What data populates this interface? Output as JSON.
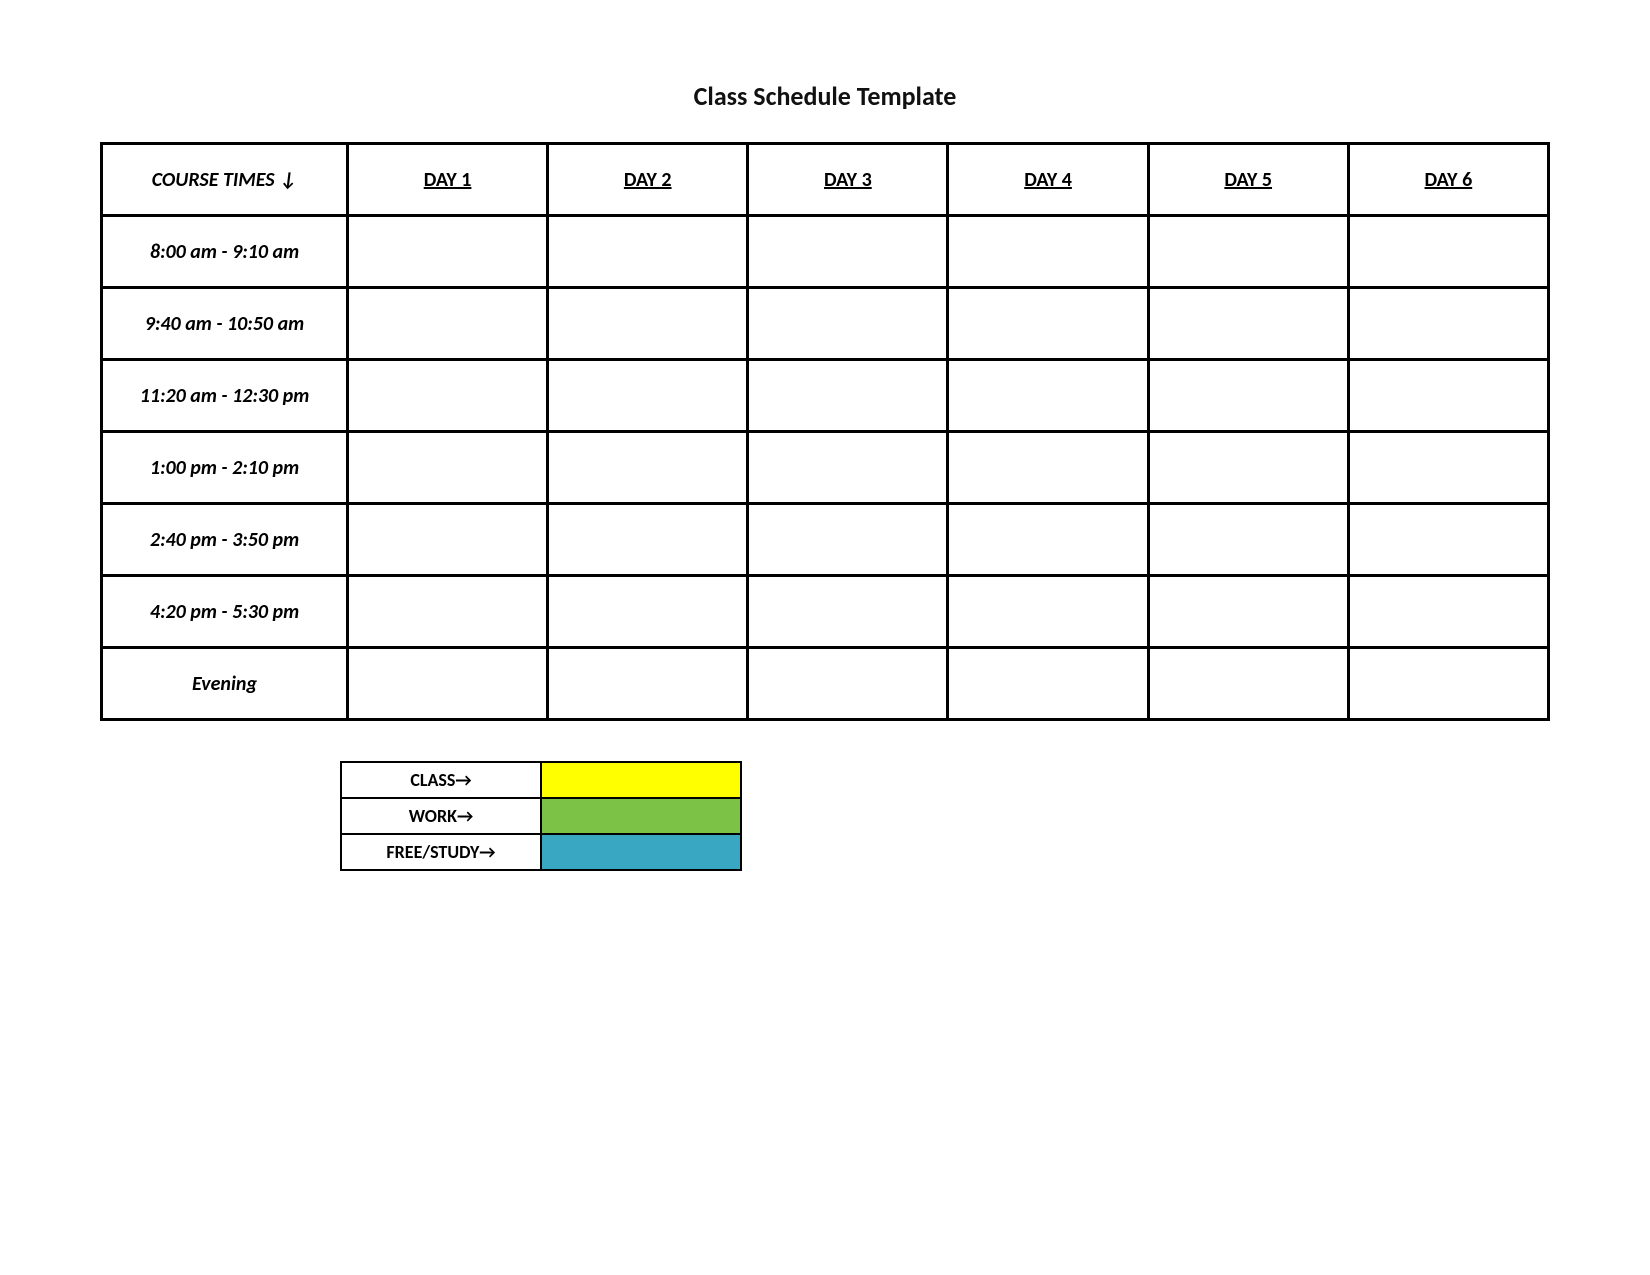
{
  "title": "Class Schedule Template",
  "schedule": {
    "corner_label": "COURSE TIMES  ↓",
    "days": [
      "DAY 1",
      "DAY 2",
      "DAY 3",
      "DAY 4",
      "DAY 5",
      "DAY 6"
    ],
    "times": [
      "8:00 am - 9:10 am",
      "9:40 am - 10:50 am",
      "11:20 am - 12:30 pm",
      "1:00 pm - 2:10 pm",
      "2:40 pm - 3:50 pm",
      "4:20 pm - 5:30 pm",
      "Evening"
    ]
  },
  "legend": {
    "items": [
      {
        "label": "CLASS→",
        "color": "#FFFF00"
      },
      {
        "label": "WORK→",
        "color": "#7CC247"
      },
      {
        "label": "FREE/STUDY→",
        "color": "#3AA7C2"
      }
    ]
  }
}
